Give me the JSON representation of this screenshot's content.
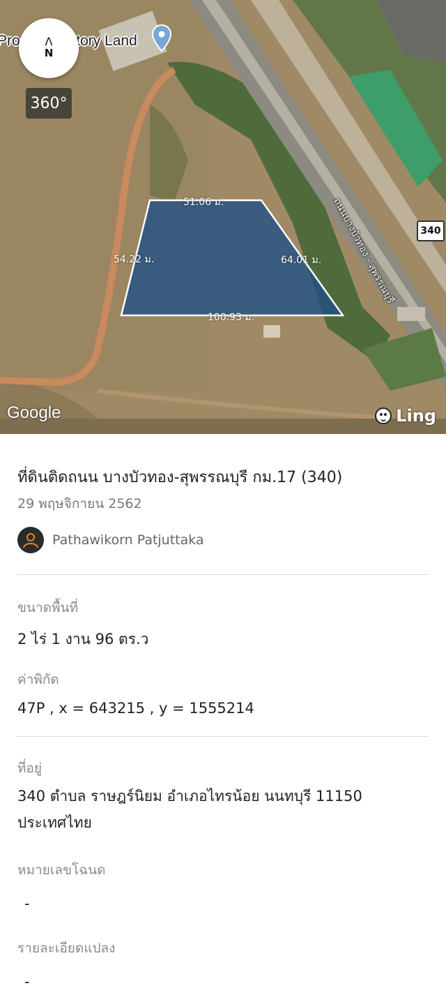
{
  "map": {
    "compass_arrow": "Λ",
    "compass_north": "N",
    "view360_label": "360°",
    "place_label_visible_start": "Pro",
    "place_label_visible_end": "ctory Land",
    "dimensions": {
      "top": "51.06 ม.",
      "left": "54.22 ม.",
      "right": "64.01 ม.",
      "bottom": "100.93 ม."
    },
    "road_label": "ถนนบางบัวทอง - สุพรรณบุรี",
    "route_number": "340",
    "google_logo": "Google",
    "ling_brand": "Ling",
    "plot_color": "#1e4f87",
    "pin_color": "#7aa6d6"
  },
  "listing": {
    "title": "ที่ดินติดถนน บางบัวทอง-สุพรรณบุรี กม.17 (340)",
    "date": "29 พฤษจิกายน 2562",
    "user_name": "Pathawikorn Patjuttaka"
  },
  "details": {
    "area_label": "ขนาดพื้นที่",
    "area_value": "2 ไร่ 1 งาน 96 ตร.ว",
    "coord_label": "ค่าพิกัด",
    "coord_value": "47P , x = 643215 , y = 1555214",
    "address_label": "ที่อยู่",
    "address_line1": "340 ตำบล ราษฎร์นิยม อำเภอไทรน้อย นนทบุรี 11150",
    "address_line2": "ประเทศไทย",
    "deed_label": "หมายเลขโฉนด",
    "deed_value": "-",
    "plot_detail_label": "รายละเอียดแปลง",
    "plot_detail_value": "-"
  }
}
